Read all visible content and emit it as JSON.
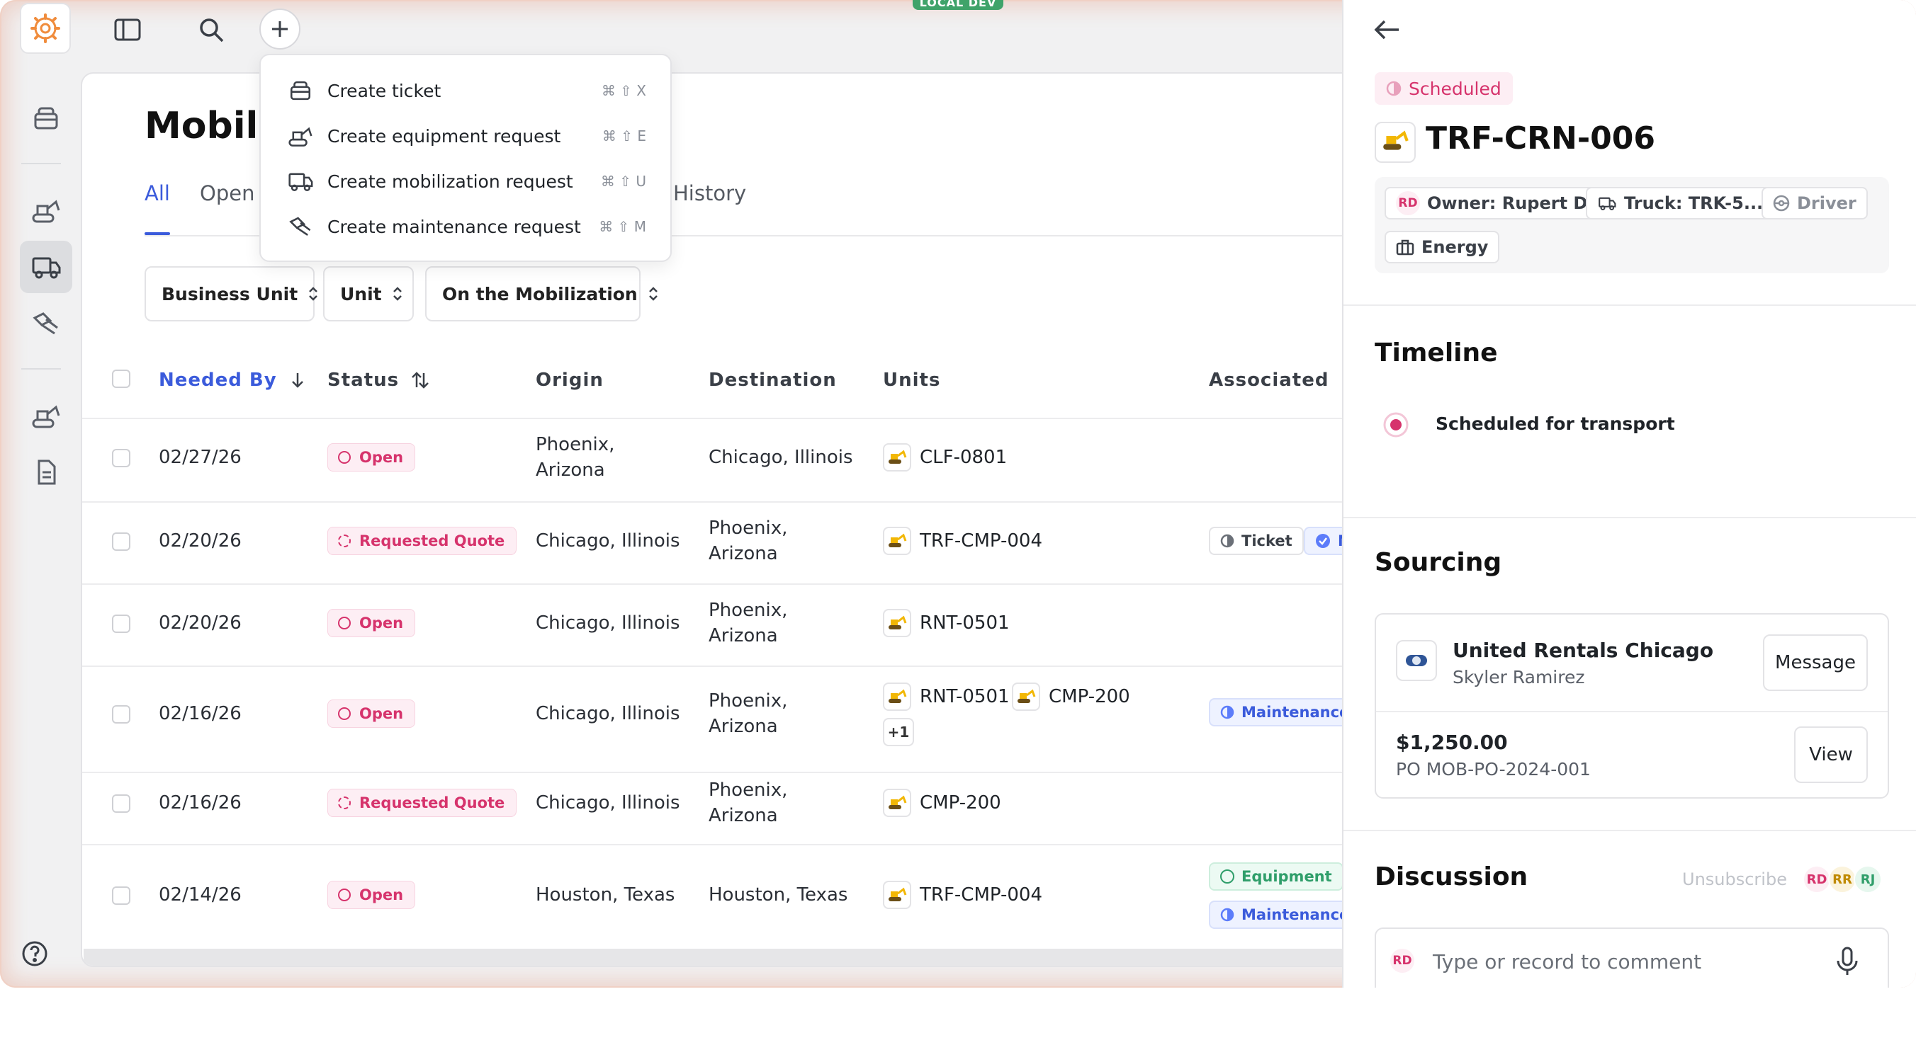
{
  "env_badge": "LOCAL DEV",
  "page_title": "Mobilizations",
  "tabs": [
    {
      "label": "All"
    },
    {
      "label": "Open"
    },
    {
      "label": "History"
    }
  ],
  "filters": [
    {
      "label": "Business Unit"
    },
    {
      "label": "Unit"
    },
    {
      "label": "On the Mobilization"
    }
  ],
  "table": {
    "columns": [
      "Needed By",
      "Status",
      "Origin",
      "Destination",
      "Units",
      "Associated"
    ],
    "rows": [
      {
        "date": "02/27/26",
        "status": "Open",
        "origin": [
          "Phoenix,",
          "Arizona"
        ],
        "destination": [
          "Chicago, Illinois"
        ],
        "units": [
          "CLF-0801"
        ]
      },
      {
        "date": "02/20/26",
        "status": "Requested Quote",
        "origin": [
          "Chicago, Illinois"
        ],
        "destination": [
          "Phoenix,",
          "Arizona"
        ],
        "units": [
          "TRF-CMP-004"
        ],
        "associated": [
          "Ticket",
          "N"
        ]
      },
      {
        "date": "02/20/26",
        "status": "Open",
        "origin": [
          "Chicago, Illinois"
        ],
        "destination": [
          "Phoenix,",
          "Arizona"
        ],
        "units": [
          "RNT-0501"
        ]
      },
      {
        "date": "02/16/26",
        "status": "Open",
        "origin": [
          "Chicago, Illinois"
        ],
        "destination": [
          "Phoenix,",
          "Arizona"
        ],
        "units": [
          "RNT-0501",
          "CMP-200"
        ],
        "more": "+1",
        "associated": [
          "Maintenance"
        ]
      },
      {
        "date": "02/16/26",
        "status": "Requested Quote",
        "origin": [
          "Chicago, Illinois"
        ],
        "destination": [
          "Phoenix,",
          "Arizona"
        ],
        "units": [
          "CMP-200"
        ]
      },
      {
        "date": "02/14/26",
        "status": "Open",
        "origin": [
          "Houston, Texas"
        ],
        "destination": [
          "Houston, Texas"
        ],
        "units": [
          "TRF-CMP-004"
        ],
        "associated": [
          "Equipment",
          "Maintenance"
        ]
      }
    ]
  },
  "create_menu": {
    "items": [
      {
        "label": "Create ticket",
        "shortcut": "⌘ ⇧ X",
        "icon": "ticket-icon"
      },
      {
        "label": "Create equipment request",
        "shortcut": "⌘ ⇧ E",
        "icon": "excavator-icon"
      },
      {
        "label": "Create mobilization request",
        "shortcut": "⌘ ⇧ U",
        "icon": "truck-icon"
      },
      {
        "label": "Create maintenance request",
        "shortcut": "⌘ ⇧ M",
        "icon": "wrench-icon"
      }
    ]
  },
  "panel": {
    "status": "Scheduled",
    "asset_id": "TRF-CRN-006",
    "meta": {
      "owner_initials": "RD",
      "owner": "Owner: Rupert D.",
      "truck": "Truck: TRK-5...",
      "driver": "Driver",
      "business_unit": "Energy"
    },
    "timeline_title": "Timeline",
    "timeline": [
      {
        "label": "Scheduled for transport"
      }
    ],
    "sourcing_title": "Sourcing",
    "vendor": {
      "name": "United Rentals Chicago",
      "contact": "Skyler Ramirez",
      "message_label": "Message"
    },
    "quote": {
      "amount": "$1,250.00",
      "po": "PO MOB-PO-2024-001",
      "view_label": "View"
    },
    "discussion_title": "Discussion",
    "unsubscribe_label": "Unsubscribe",
    "participants": [
      "RD",
      "RR",
      "RJ"
    ],
    "comment_initials": "RD",
    "comment_placeholder": "Type or record to comment"
  },
  "colors": {
    "accent": "#3b5bdb",
    "status_pink": "#d6336c",
    "env_green": "#3fa36a"
  }
}
